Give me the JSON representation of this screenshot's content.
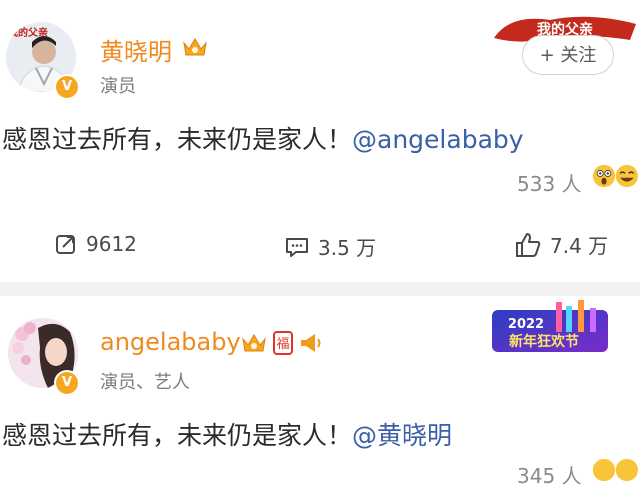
{
  "post1": {
    "username": "黄晓明",
    "role": "演员",
    "follow_label": "+ 关注",
    "text_main": "感恩过去所有，未来仍是家人！",
    "text_mention": "@angelababy",
    "reaction_count": "533 人",
    "actions": {
      "repost": "9612",
      "comment": "3.5 万",
      "like": "7.4 万"
    },
    "avatar_caption": "我的父亲",
    "banner_caption": "我的父亲"
  },
  "post2": {
    "username": "angelababy",
    "role": "演员、艺人",
    "badge_fu": "福",
    "text_main": "感恩过去所有，未来仍是家人！",
    "text_mention": "@黄晓明",
    "reaction_count": "345 人",
    "banner_year": "2022",
    "banner_text": "新年狂欢节"
  },
  "colors": {
    "username": "#f08a1f",
    "mention": "#3a5fa8",
    "verified": "#f5a623",
    "divider": "#f2f2f2"
  }
}
